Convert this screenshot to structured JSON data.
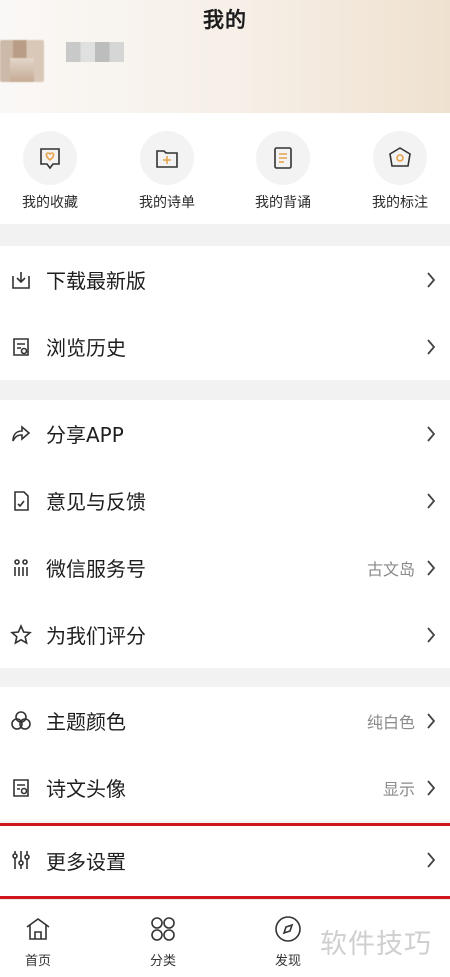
{
  "header": {
    "title": "我的"
  },
  "quick_actions": [
    {
      "label": "我的收藏",
      "icon": "favorites-icon"
    },
    {
      "label": "我的诗单",
      "icon": "folder-add-icon"
    },
    {
      "label": "我的背诵",
      "icon": "recite-doc-icon"
    },
    {
      "label": "我的标注",
      "icon": "tag-icon"
    }
  ],
  "menu": {
    "download": {
      "label": "下载最新版",
      "icon": "download-icon"
    },
    "history": {
      "label": "浏览历史",
      "icon": "history-icon"
    },
    "share": {
      "label": "分享APP",
      "icon": "share-icon"
    },
    "feedback": {
      "label": "意见与反馈",
      "icon": "feedback-icon"
    },
    "wechat": {
      "label": "微信服务号",
      "value": "古文岛",
      "icon": "wechat-icon"
    },
    "rate": {
      "label": "为我们评分",
      "icon": "star-icon"
    },
    "theme": {
      "label": "主题颜色",
      "value": "纯白色",
      "icon": "theme-icon"
    },
    "avatar": {
      "label": "诗文头像",
      "value": "显示",
      "icon": "poem-avatar-icon"
    },
    "settings": {
      "label": "更多设置",
      "icon": "settings-icon"
    }
  },
  "tabbar": [
    {
      "label": "首页",
      "icon": "home-icon"
    },
    {
      "label": "分类",
      "icon": "category-icon"
    },
    {
      "label": "发现",
      "icon": "discover-icon"
    }
  ],
  "watermark": "软件技巧",
  "colors": {
    "accent": "#e8a24a",
    "highlight": "#d0161c",
    "icon": "#3a3a3a"
  }
}
